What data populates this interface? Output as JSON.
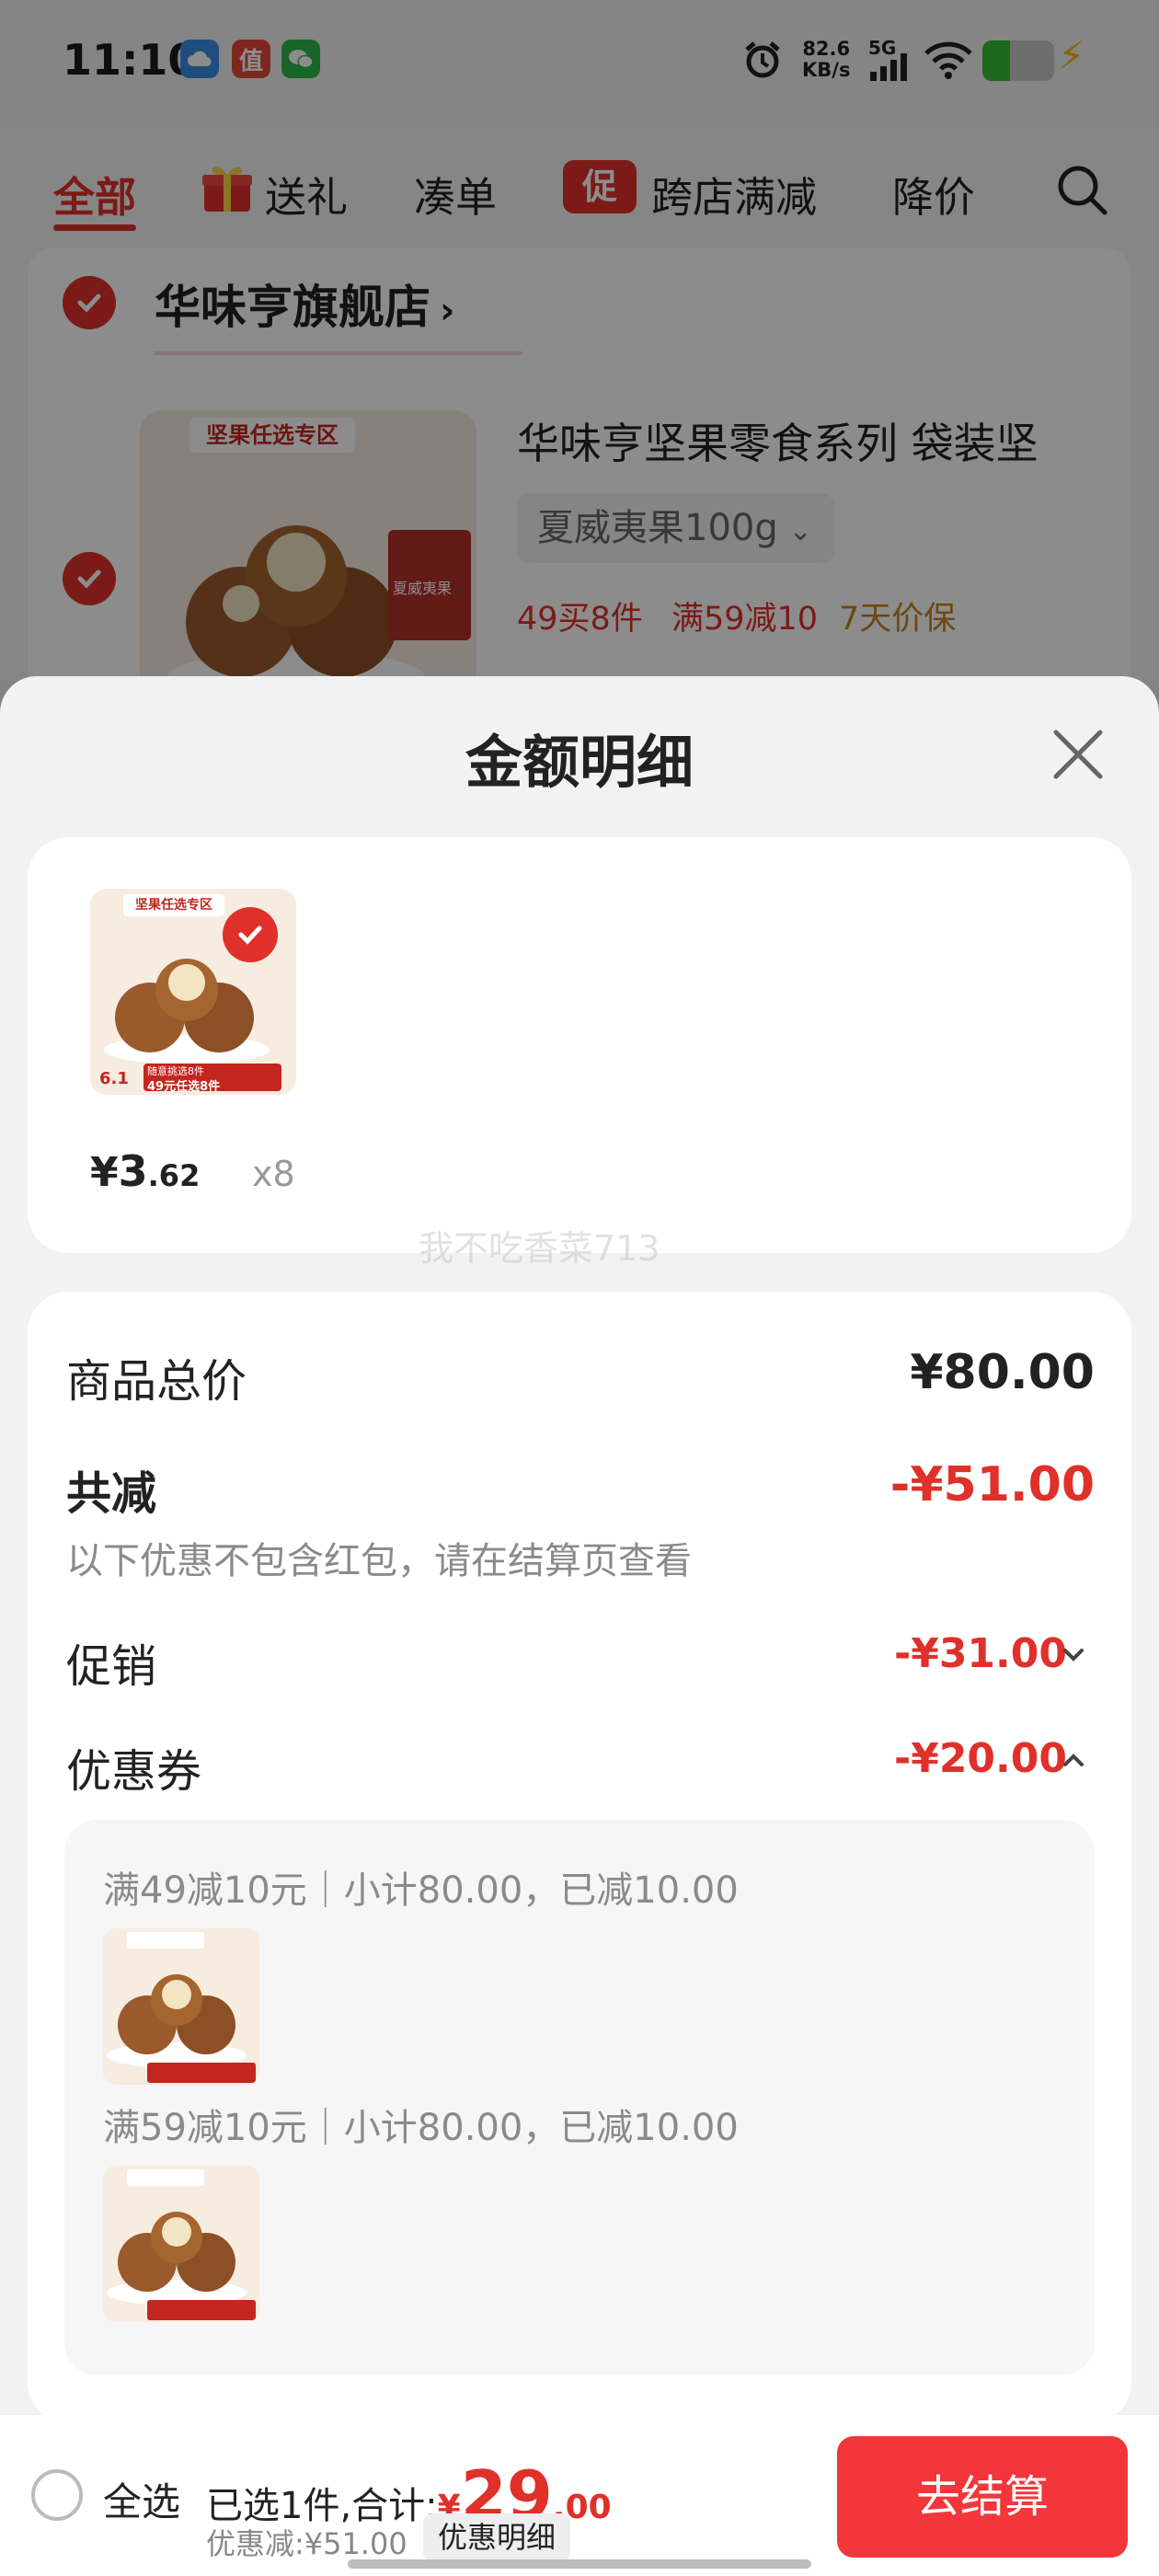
{
  "status_bar": {
    "time": "11:10",
    "net_speed": "82.6",
    "net_unit": "KB/s",
    "network": "5G",
    "bolt": "⚡",
    "apps": [
      "cloud-icon",
      "zhi-icon",
      "wechat-icon"
    ],
    "zhi_char": "值"
  },
  "nav_tabs": [
    {
      "label": "全部",
      "active": true
    },
    {
      "label": "送礼",
      "icon": "gift-icon"
    },
    {
      "label": "凑单"
    },
    {
      "label": "跨店满减",
      "badge": "促"
    },
    {
      "label": "降价"
    }
  ],
  "store": {
    "name": "华味亨旗舰店",
    "chevron": "›"
  },
  "product": {
    "title": "华味亨坚果零食系列 袋装坚",
    "variant": "夏威夷果100g",
    "variant_chevron": "⌄",
    "tags": [
      "49买8件",
      "满59减10",
      "7天价保"
    ],
    "banner": "坚果任选专区",
    "label_on_bag": "夏威夷果"
  },
  "sheet": {
    "title": "金额明细",
    "item": {
      "price_symbol": "¥",
      "price_int": "3",
      "price_dec": ".62",
      "qty": "x8",
      "img_date": "6.1",
      "img_line1": "随意挑选8件",
      "img_line2": "49元任选8件",
      "img_banner": "坚果任选专区"
    },
    "watermark": "我不吃香菜713",
    "total_label": "商品总价",
    "total_value": "¥80.00",
    "reduce_label": "共减",
    "reduce_value": "-¥51.00",
    "reduce_note": "以下优惠不包含红包，请在结算页查看",
    "promo_label": "促销",
    "promo_value": "-¥31.00",
    "coupon_label": "优惠券",
    "coupon_value": "-¥20.00",
    "coupons": [
      {
        "text": "满49减10元｜小计80.00，已减10.00"
      },
      {
        "text": "满59减10元｜小计80.00，已减10.00"
      }
    ]
  },
  "bottom": {
    "select_all": "全选",
    "selected_text": "已选1件,合计:",
    "currency": "¥",
    "total_int": "29",
    "total_dec": ".00",
    "discount_text": "优惠减:¥51.00",
    "detail_button": "优惠明细",
    "checkout": "去结算"
  },
  "colors": {
    "accent": "#e0302a",
    "gold": "#c8811a",
    "gray_text": "#8a8a8a"
  }
}
